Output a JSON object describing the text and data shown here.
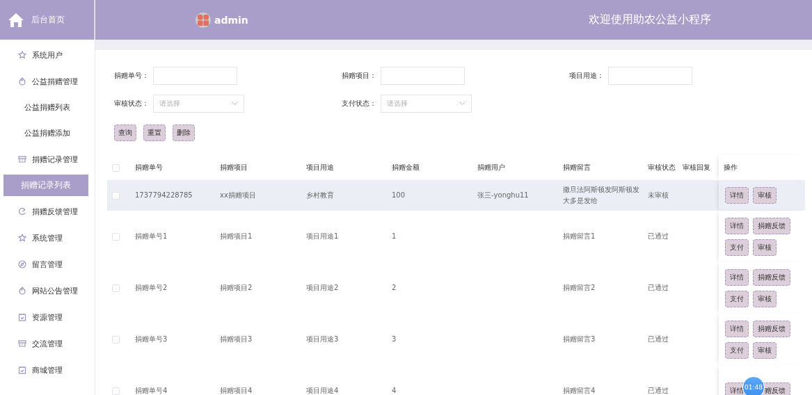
{
  "sidebar": {
    "home": "后台首页",
    "items": [
      {
        "label": "系统用户",
        "selected": false
      },
      {
        "label": "公益捐赠管理",
        "selected": false,
        "children": [
          {
            "label": "公益捐赠列表",
            "selected": false
          },
          {
            "label": "公益捐赠添加",
            "selected": false
          }
        ]
      },
      {
        "label": "捐赠记录管理",
        "selected": false,
        "children": [
          {
            "label": "捐赠记录列表",
            "selected": true
          }
        ]
      },
      {
        "label": "捐赠反馈管理",
        "selected": false
      },
      {
        "label": "系统管理",
        "selected": false
      },
      {
        "label": "留言管理",
        "selected": false
      },
      {
        "label": "网站公告管理",
        "selected": false
      },
      {
        "label": "资源管理",
        "selected": false
      },
      {
        "label": "交流管理",
        "selected": false
      },
      {
        "label": "商城管理",
        "selected": false
      }
    ]
  },
  "header": {
    "user": "admin",
    "title": "欢迎使用助农公益小程序"
  },
  "search": {
    "fields": [
      {
        "kind": "input",
        "label": "捐赠单号："
      },
      {
        "kind": "input",
        "label": "捐赠项目："
      },
      {
        "kind": "input",
        "label": "项目用途："
      },
      {
        "kind": "select",
        "label": "审核状态：",
        "placeholder": "请选择"
      },
      {
        "kind": "select",
        "label": "支付状态：",
        "placeholder": "请选择"
      }
    ],
    "buttons": [
      "查询",
      "重置",
      "删除"
    ]
  },
  "table": {
    "header_checked": false,
    "columns": [
      "捐赠单号",
      "捐赠项目",
      "项目用途",
      "捐赠金额",
      "捐赠用户",
      "捐赠留言",
      "审核状态",
      "审核回复"
    ],
    "actions_column": "操作",
    "rows": [
      {
        "checked": false,
        "highlighted": true,
        "cells": [
          "1737794228785",
          "xx捐赠项目",
          "乡村教育",
          "100",
          "张三-yonghu11",
          "撒旦法阿斯顿发阿斯顿发大多是发给",
          "未审核",
          ""
        ],
        "actions": [
          "详情",
          "审核"
        ]
      },
      {
        "checked": false,
        "highlighted": false,
        "cells": [
          "捐赠单号1",
          "捐赠项目1",
          "项目用途1",
          "1",
          "",
          "捐赠留言1",
          "已通过",
          ""
        ],
        "actions": [
          "详情",
          "捐赠反馈",
          "支付",
          "审核"
        ]
      },
      {
        "checked": false,
        "highlighted": false,
        "cells": [
          "捐赠单号2",
          "捐赠项目2",
          "项目用途2",
          "2",
          "",
          "捐赠留言2",
          "已通过",
          ""
        ],
        "actions": [
          "详情",
          "捐赠反馈",
          "支付",
          "审核"
        ]
      },
      {
        "checked": false,
        "highlighted": false,
        "cells": [
          "捐赠单号3",
          "捐赠项目3",
          "项目用途3",
          "3",
          "",
          "捐赠留言3",
          "已通过",
          ""
        ],
        "actions": [
          "详情",
          "捐赠反馈",
          "支付",
          "审核"
        ]
      },
      {
        "checked": false,
        "highlighted": false,
        "cells": [
          "捐赠单号4",
          "捐赠项目4",
          "项目用途4",
          "4",
          "",
          "捐赠留言4",
          "已通过",
          ""
        ],
        "actions": [
          "详情",
          "赠反馈"
        ]
      }
    ]
  },
  "timer": "01:48"
}
